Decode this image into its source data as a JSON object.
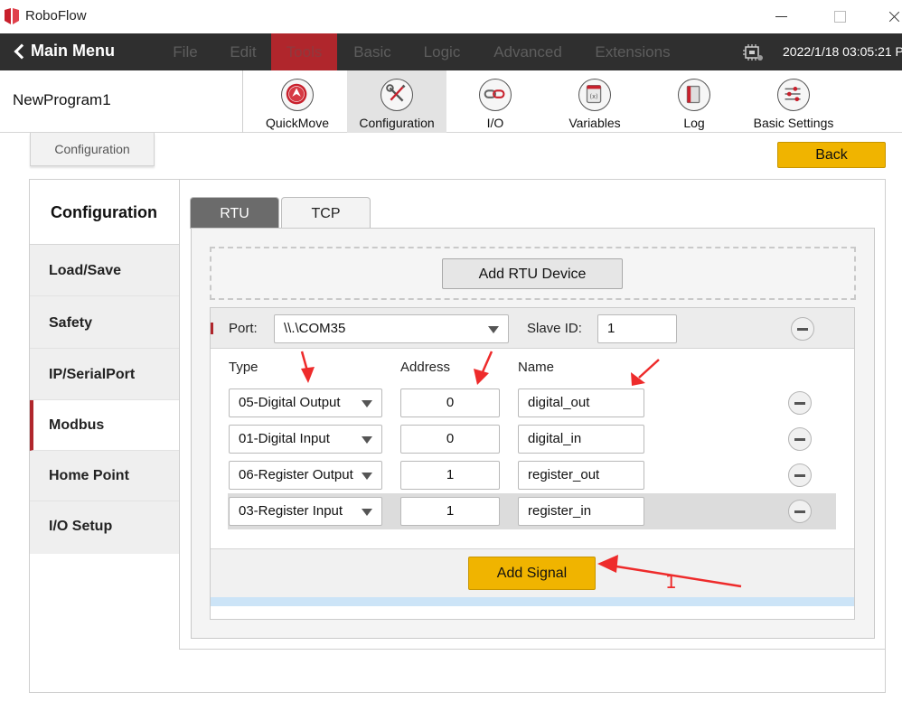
{
  "window": {
    "title": "RoboFlow"
  },
  "menubar": {
    "main_menu": "Main Menu",
    "items": [
      "File",
      "Edit",
      "Tools",
      "Basic",
      "Logic",
      "Advanced",
      "Extensions"
    ],
    "active_item": "Tools",
    "datetime": "2022/1/18 03:05:21 P"
  },
  "toolbar": {
    "program_name": "NewProgram1",
    "tools": [
      {
        "label": "QuickMove",
        "icon": "quickmove-icon"
      },
      {
        "label": "Configuration",
        "icon": "wrench-screwdriver-icon"
      },
      {
        "label": "I/O",
        "icon": "io-link-icon"
      },
      {
        "label": "Variables",
        "icon": "variables-icon"
      },
      {
        "label": "Log",
        "icon": "log-book-icon"
      },
      {
        "label": "Basic Settings",
        "icon": "sliders-icon"
      }
    ],
    "active_tool": "Configuration"
  },
  "breadcrumb": {
    "label": "Configuration"
  },
  "back_button": {
    "label": "Back"
  },
  "sidebar": {
    "header": "Configuration",
    "items": [
      "Load/Save",
      "Safety",
      "IP/SerialPort",
      "Modbus",
      "Home Point",
      "I/O Setup"
    ],
    "selected": "Modbus"
  },
  "tabs": {
    "items": [
      "RTU",
      "TCP"
    ],
    "active": "RTU"
  },
  "rtu": {
    "add_device_label": "Add RTU Device",
    "device": {
      "port_label": "Port:",
      "port_value": "\\\\.\\COM35",
      "slave_label": "Slave ID:",
      "slave_value": "1"
    },
    "columns": {
      "type": "Type",
      "address": "Address",
      "name": "Name"
    },
    "signals": [
      {
        "type": "05-Digital Output",
        "address": "0",
        "name": "digital_out"
      },
      {
        "type": "01-Digital Input",
        "address": "0",
        "name": "digital_in"
      },
      {
        "type": "06-Register Output",
        "address": "1",
        "name": "register_out"
      },
      {
        "type": "03-Register Input",
        "address": "1",
        "name": "register_in"
      }
    ],
    "add_signal_label": "Add Signal"
  },
  "annotation": {
    "number": "1"
  },
  "colors": {
    "accent_red": "#b0262c",
    "button_yellow": "#f0b400",
    "menubar_bg": "#2f2f2f",
    "arrow_red": "#ee2b2b"
  }
}
